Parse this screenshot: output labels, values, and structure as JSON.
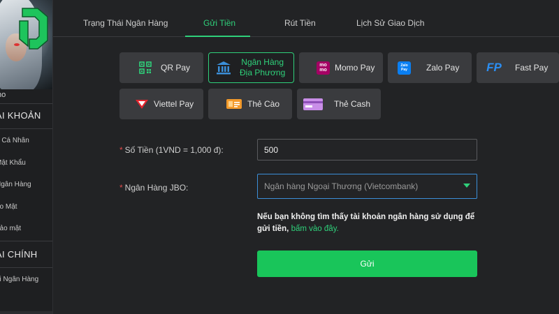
{
  "sidebar": {
    "user_name": "ho",
    "section1_title": "ÀI KHOẢN",
    "section1_items": [
      "n Cá Nhân",
      "Mật Khẩu",
      "Ngân Hàng",
      "ảo Mật",
      "bảo mật"
    ],
    "section2_title": "ÀI CHÍNH",
    "section2_items": [
      "ái Ngân Hàng"
    ]
  },
  "tabs": [
    {
      "label": "Trạng Thái Ngân Hàng",
      "active": false
    },
    {
      "label": "Gửi Tiền",
      "active": true
    },
    {
      "label": "Rút Tiền",
      "active": false
    },
    {
      "label": "Lịch Sử Giao Dịch",
      "active": false
    }
  ],
  "payment_methods": [
    {
      "label": "QR Pay",
      "icon": "qr-code-icon"
    },
    {
      "label_line1": "Ngân Hàng",
      "label_line2": "Địa Phương",
      "icon": "bank-icon",
      "active": true
    },
    {
      "label": "Momo Pay",
      "icon": "momo-icon"
    },
    {
      "label": "Zalo Pay",
      "icon": "zalo-icon"
    },
    {
      "label": "Fast Pay",
      "icon": "fastpay-icon"
    },
    {
      "label": "Viettel Pay",
      "icon": "viettel-icon"
    },
    {
      "label": "Thẻ Cào",
      "icon": "scratch-card-icon"
    },
    {
      "label": "Thẻ Cash",
      "icon": "cash-card-icon"
    }
  ],
  "icon_text": {
    "momo": "mo mo",
    "zalo": "Zalo Pay",
    "fastpay": "FP"
  },
  "form": {
    "amount_label": "Số Tiền (1VND = 1,000 đ):",
    "amount_value": "500",
    "bank_label": "Ngân Hàng JBO:",
    "bank_selected": "Ngân hàng Ngoại Thương (Vietcombank)",
    "required_mark": "*",
    "note_text": "Nếu bạn không tìm thấy tài khoản ngân hàng sử dụng để gửi tiền,",
    "note_link": "bấm vào đây.",
    "submit_label": "Gửi"
  },
  "colors": {
    "accent": "#2fd07a",
    "submit": "#19c55a",
    "background": "#222325",
    "tile": "#3a3b3e"
  }
}
